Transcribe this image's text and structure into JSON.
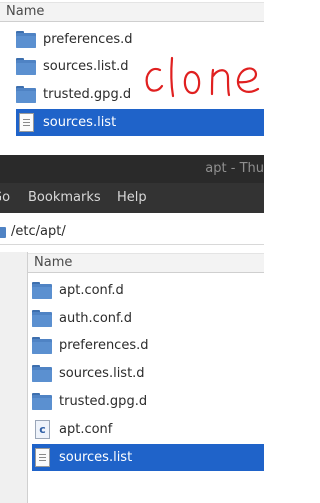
{
  "top_panel": {
    "column_header": "Name",
    "items": [
      {
        "label": "preferences.d",
        "icon": "folder-icon"
      },
      {
        "label": "sources.list.d",
        "icon": "folder-icon"
      },
      {
        "label": "trusted.gpg.d",
        "icon": "folder-icon"
      },
      {
        "label": "sources.list",
        "icon": "text-file-icon",
        "selected": true
      }
    ],
    "annotation": "clone"
  },
  "window": {
    "title": "apt - Thu"
  },
  "menubar": {
    "items": [
      "Go",
      "Bookmarks",
      "Help"
    ],
    "visible_labels": [
      "o",
      "Bookmarks",
      "Help"
    ]
  },
  "location": {
    "path": "/etc/apt/"
  },
  "bottom_panel": {
    "column_header": "Name",
    "items": [
      {
        "label": "apt.conf.d",
        "icon": "folder-icon"
      },
      {
        "label": "auth.conf.d",
        "icon": "folder-icon"
      },
      {
        "label": "preferences.d",
        "icon": "folder-icon"
      },
      {
        "label": "sources.list.d",
        "icon": "folder-icon"
      },
      {
        "label": "trusted.gpg.d",
        "icon": "folder-icon"
      },
      {
        "label": "apt.conf",
        "icon": "c-source-file-icon"
      },
      {
        "label": "sources.list",
        "icon": "text-file-icon",
        "selected": true
      }
    ]
  },
  "colors": {
    "selection": "#1f63c9",
    "folder": "#4f83c4",
    "annotation_ink": "#e02020",
    "titlebar": "#2a2a2a",
    "menubar": "#333333"
  }
}
